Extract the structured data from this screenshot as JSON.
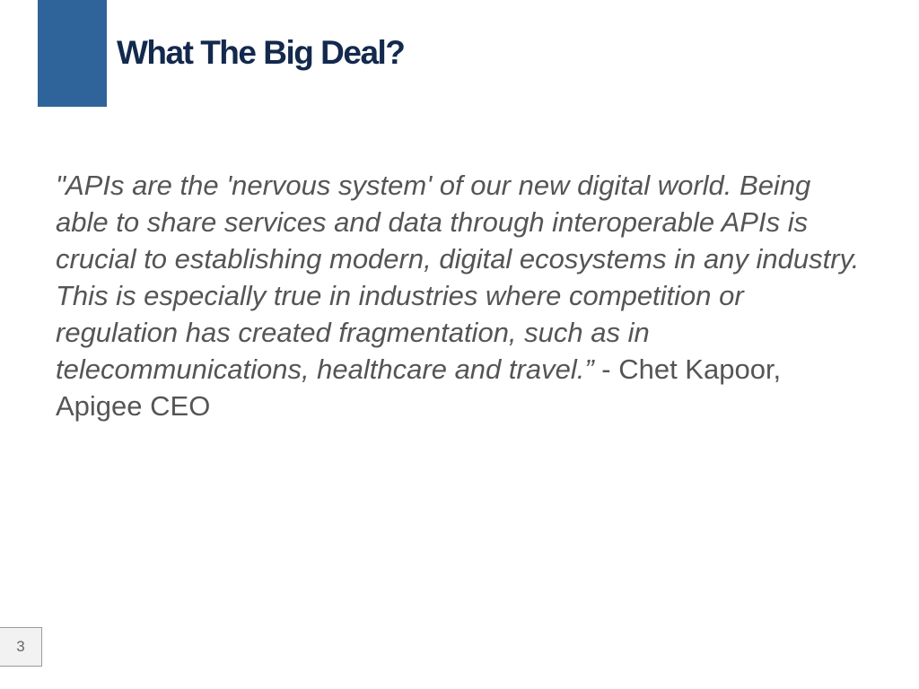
{
  "slide": {
    "title": "What The Big Deal?",
    "quote": "\"APIs are the 'nervous system' of our new digital world. Being able to share services and data through interoperable APIs is crucial to establishing modern, digital ecosystems in any industry. This is especially true in industries where competition or regulation has created fragmentation, such as in telecommunications, healthcare and travel.”",
    "attribution": " - Chet Kapoor, Apigee CEO",
    "page_number": "3"
  },
  "colors": {
    "accent": "#2e6499",
    "title": "#13294d",
    "body_text": "#555555"
  }
}
